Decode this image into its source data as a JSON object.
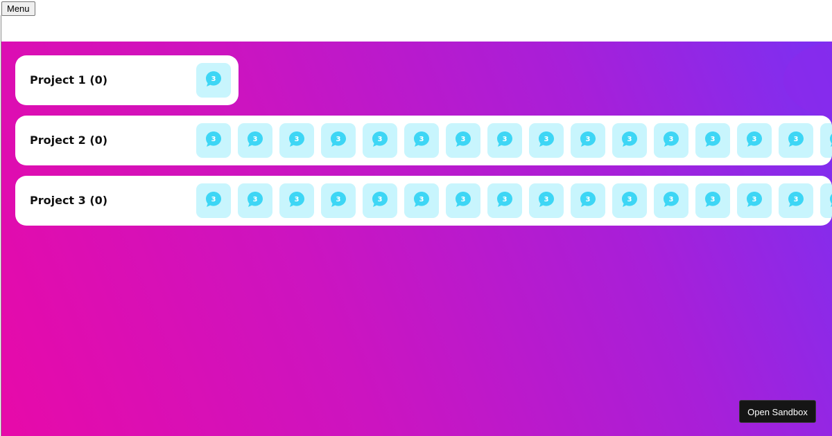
{
  "header": {
    "menu_label": "Menu"
  },
  "projects": [
    {
      "title": "Project 1 (0)",
      "visible_tiles": 1
    },
    {
      "title": "Project 2 (0)",
      "visible_tiles": 16
    },
    {
      "title": "Project 3 (0)",
      "visible_tiles": 16
    }
  ],
  "tile": {
    "icon": "chat-bubble-icon",
    "badge": "3",
    "icon_color": "#3dd6f5",
    "background_color": "#c8f5fd"
  },
  "footer": {
    "sandbox_label": "Open Sandbox"
  },
  "colors": {
    "gradient_start": "#e70aa9",
    "gradient_end": "#7b30f2",
    "card_background": "#ffffff"
  }
}
